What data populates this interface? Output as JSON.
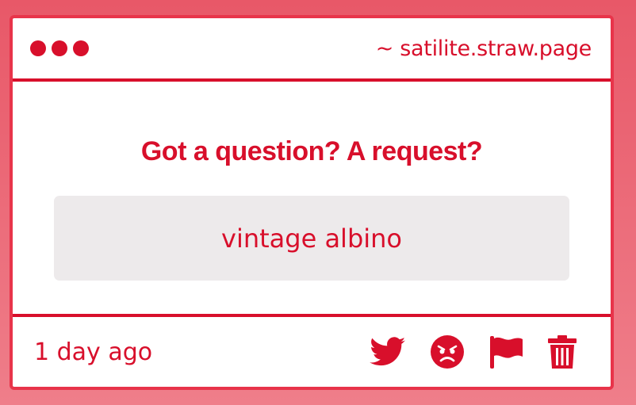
{
  "titlebar": {
    "url": "~ satilite.straw.page"
  },
  "main": {
    "question": "Got a question? A request?",
    "answer": "vintage albino"
  },
  "footer": {
    "time": "1 day ago",
    "actions": [
      {
        "name": "twitter-icon"
      },
      {
        "name": "angry-face-icon"
      },
      {
        "name": "flag-icon"
      },
      {
        "name": "trash-icon"
      }
    ]
  },
  "colors": {
    "accent": "#d80f2b",
    "background_top": "#e85868",
    "background_bottom": "#ef7e8a",
    "answer_bg": "#edeaeb"
  }
}
